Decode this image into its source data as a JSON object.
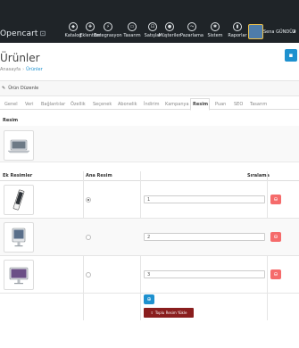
{
  "app": {
    "logo": "Opencart",
    "logo_icon": "cart-icon"
  },
  "nav": {
    "items": [
      {
        "label": "Katalog",
        "icon": "tag-icon"
      },
      {
        "label": "Eklentiler",
        "icon": "puzzle-icon"
      },
      {
        "label": "Entegrasyon",
        "icon": "plug-icon"
      },
      {
        "label": "Tasarım",
        "icon": "desktop-icon"
      },
      {
        "label": "Satışlar",
        "icon": "cart-icon"
      },
      {
        "label": "Müşteriler",
        "icon": "user-icon"
      },
      {
        "label": "Pazarlama",
        "icon": "share-icon"
      },
      {
        "label": "Sistem",
        "icon": "gear-icon"
      },
      {
        "label": "Raporlar",
        "icon": "chart-icon"
      }
    ],
    "user_name": "Sena GÜNDÜZ"
  },
  "page": {
    "title": "Ürünler",
    "breadcrumb": [
      "Anasayfa",
      "Ürünler"
    ]
  },
  "panel": {
    "title": "Ürün Düzenle"
  },
  "tabs": [
    "Genel",
    "Veri",
    "Bağlantılar",
    "Özellik",
    "Seçenek",
    "Abonelik",
    "İndirim",
    "Kampanya",
    "Resim",
    "Puan",
    "SEO",
    "Tasarım"
  ],
  "active_tab": "Resim",
  "image_section": {
    "heading": "Resim"
  },
  "additional_images": {
    "headers": {
      "images": "Ek Resimler",
      "main": "Ana Resim",
      "sort": "Sıralama"
    },
    "rows": [
      {
        "sort_order": "1",
        "main": true
      },
      {
        "sort_order": "2",
        "main": false
      },
      {
        "sort_order": "3",
        "main": false
      }
    ],
    "bulk_upload_label": "Toplu Resim Yükle"
  },
  "colors": {
    "topbar": "#1f2428",
    "primary": "#1e91cf",
    "danger": "#f56b6b",
    "bulk": "#8a1e1e"
  }
}
